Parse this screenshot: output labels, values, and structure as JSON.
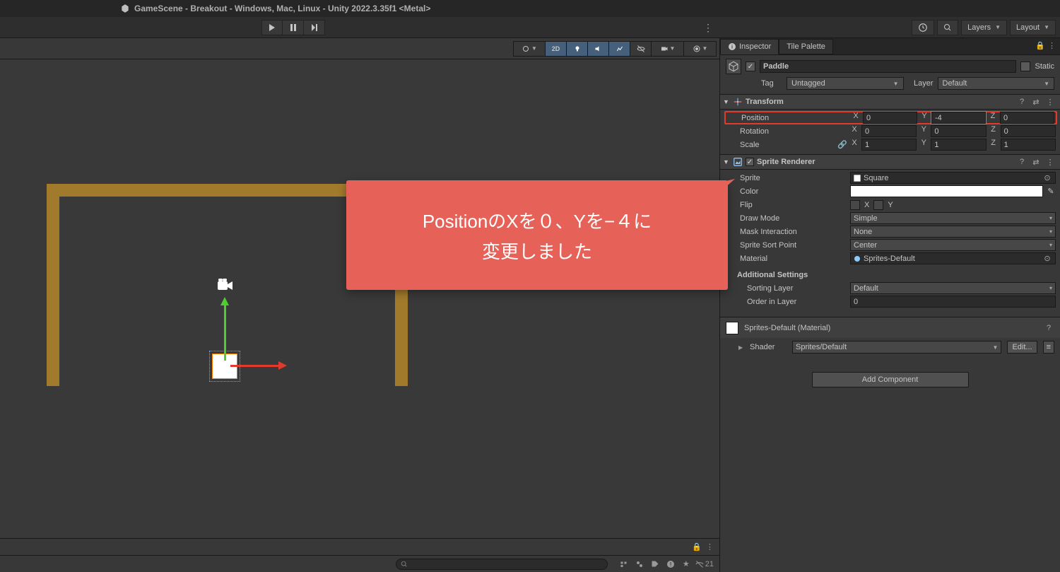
{
  "titlebar": "GameScene - Breakout - Windows, Mac, Linux - Unity 2022.3.35f1 <Metal>",
  "layers_dd": "Layers",
  "layout_dd": "Layout",
  "scene_overlay": {
    "mode": "2D"
  },
  "callout": {
    "line1": "PositionのXを０、Yを−４に",
    "line2": "変更しました"
  },
  "console_count": "21",
  "tabs": {
    "inspector": "Inspector",
    "tilepalette": "Tile Palette"
  },
  "obj": {
    "name": "Paddle",
    "static": "Static",
    "tag_label": "Tag",
    "tag_value": "Untagged",
    "layer_label": "Layer",
    "layer_value": "Default"
  },
  "transform": {
    "title": "Transform",
    "position": {
      "label": "Position",
      "x": "0",
      "y": "-4",
      "z": "0"
    },
    "rotation": {
      "label": "Rotation",
      "x": "0",
      "y": "0",
      "z": "0"
    },
    "scale": {
      "label": "Scale",
      "x": "1",
      "y": "1",
      "z": "1"
    }
  },
  "sprite": {
    "title": "Sprite Renderer",
    "sprite_label": "Sprite",
    "sprite_value": "Square",
    "color_label": "Color",
    "color_value": "#FFFFFF",
    "flip_label": "Flip",
    "flip_x": "X",
    "flip_y": "Y",
    "draw_label": "Draw Mode",
    "draw_value": "Simple",
    "mask_label": "Mask Interaction",
    "mask_value": "None",
    "sort_label": "Sprite Sort Point",
    "sort_value": "Center",
    "mat_label": "Material",
    "mat_value": "Sprites-Default",
    "additional": "Additional Settings",
    "sorting_layer_label": "Sorting Layer",
    "sorting_layer_value": "Default",
    "order_label": "Order in Layer",
    "order_value": "0"
  },
  "material": {
    "name": "Sprites-Default (Material)",
    "shader_label": "Shader",
    "shader_value": "Sprites/Default",
    "edit": "Edit..."
  },
  "add_component": "Add Component"
}
